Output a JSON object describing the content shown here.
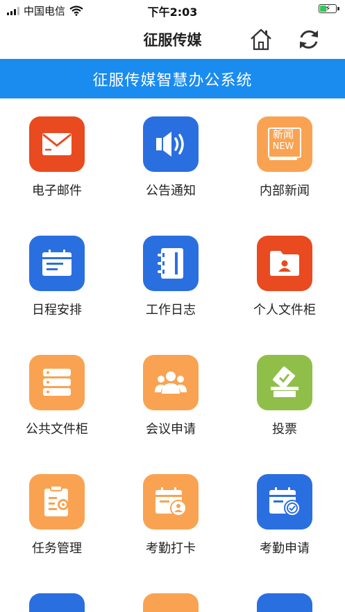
{
  "status_bar": {
    "carrier": "中国电信",
    "time": "下午2:03"
  },
  "nav": {
    "title": "征服传媒",
    "home_icon": "home-icon",
    "refresh_icon": "refresh-icon"
  },
  "banner": {
    "text": "征服传媒智慧办公系统"
  },
  "colors": {
    "blue": "#2a6fe0",
    "orange": "#f9a352",
    "red": "#e94a1f",
    "green": "#8fbf48",
    "banner": "#1a8cf0"
  },
  "grid": {
    "items": [
      {
        "label": "电子邮件",
        "icon": "mail-icon"
      },
      {
        "label": "公告通知",
        "icon": "speaker-icon"
      },
      {
        "label": "内部新闻",
        "icon": "news-icon",
        "icon_text_1": "新闻",
        "icon_text_2": "NEW"
      },
      {
        "label": "日程安排",
        "icon": "calendar-icon"
      },
      {
        "label": "工作日志",
        "icon": "notebook-icon"
      },
      {
        "label": "个人文件柜",
        "icon": "user-folder-icon"
      },
      {
        "label": "公共文件柜",
        "icon": "server-icon"
      },
      {
        "label": "会议申请",
        "icon": "group-icon"
      },
      {
        "label": "投票",
        "icon": "vote-icon"
      },
      {
        "label": "任务管理",
        "icon": "task-icon"
      },
      {
        "label": "考勤打卡",
        "icon": "clock-in-icon"
      },
      {
        "label": "考勤申请",
        "icon": "attendance-request-icon"
      }
    ]
  }
}
